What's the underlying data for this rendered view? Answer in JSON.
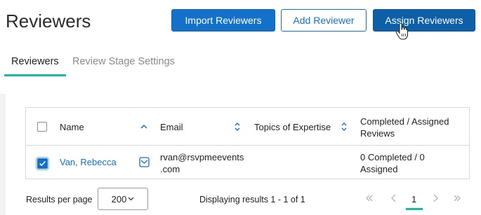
{
  "page": {
    "title": "Reviewers"
  },
  "toolbar": {
    "import_label": "Import Reviewers",
    "add_label": "Add Reviewer",
    "assign_label": "Assign Reviewers"
  },
  "tabs": [
    {
      "label": "Reviewers",
      "active": true
    },
    {
      "label": "Review Stage Settings",
      "active": false
    }
  ],
  "table": {
    "headers": {
      "name": "Name",
      "email": "Email",
      "topics": "Topics of Expertise",
      "completed_line1": "Completed / Assigned",
      "completed_line2": "Reviews"
    },
    "rows": [
      {
        "checked": true,
        "name": "Van, Rebecca",
        "email_line1": "rvan@rsvpmeevents",
        "email_line2": ".com",
        "topics": "",
        "completed_line1": "0 Completed / 0",
        "completed_line2": "Assigned"
      }
    ]
  },
  "footer": {
    "results_per_page_label": "Results per page",
    "results_per_page_value": "200",
    "display_text": "Displaying results 1 - 1 of 1",
    "current_page": "1"
  },
  "colors": {
    "primary": "#1471c9",
    "accent": "#19b8a0"
  }
}
